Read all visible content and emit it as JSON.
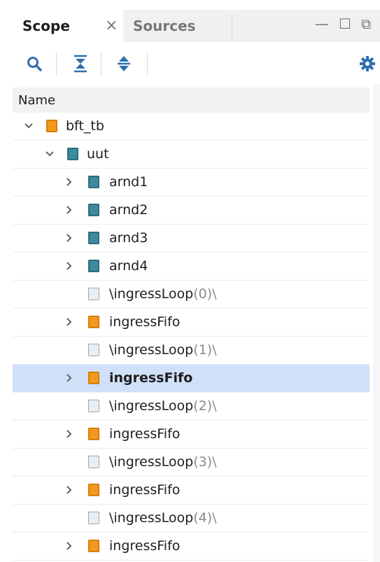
{
  "tabs": {
    "scope_label": "Scope",
    "close_glyph": "×",
    "sources_label": "Sources"
  },
  "window_controls": {
    "minimize": "—",
    "maximize": "☐",
    "float": "⧉"
  },
  "toolbar": {
    "icons": [
      "search-icon",
      "collapse-all-icon",
      "expand-all-icon",
      "gear-icon"
    ]
  },
  "tree": {
    "column_header": "Name",
    "rows": [
      {
        "label": "bft_tb",
        "suffix": "",
        "icon": "orange",
        "chevron": "down",
        "level": 0,
        "selected": false
      },
      {
        "label": "uut",
        "suffix": "",
        "icon": "teal",
        "chevron": "down",
        "level": 1,
        "selected": false
      },
      {
        "label": "arnd1",
        "suffix": "",
        "icon": "teal",
        "chevron": "right",
        "level": 2,
        "selected": false
      },
      {
        "label": "arnd2",
        "suffix": "",
        "icon": "teal",
        "chevron": "right",
        "level": 2,
        "selected": false
      },
      {
        "label": "arnd3",
        "suffix": "",
        "icon": "teal",
        "chevron": "right",
        "level": 2,
        "selected": false
      },
      {
        "label": "arnd4",
        "suffix": "",
        "icon": "teal",
        "chevron": "right",
        "level": 2,
        "selected": false
      },
      {
        "label": "\\ingressLoop",
        "suffix": "(0)\\",
        "icon": "gen",
        "chevron": "none",
        "level": 2,
        "selected": false
      },
      {
        "label": "ingressFifo",
        "suffix": "",
        "icon": "orange",
        "chevron": "right",
        "level": 2,
        "selected": false
      },
      {
        "label": "\\ingressLoop",
        "suffix": "(1)\\",
        "icon": "gen",
        "chevron": "none",
        "level": 2,
        "selected": false
      },
      {
        "label": "ingressFifo",
        "suffix": "",
        "icon": "orange",
        "chevron": "right",
        "level": 2,
        "selected": true
      },
      {
        "label": "\\ingressLoop",
        "suffix": "(2)\\",
        "icon": "gen",
        "chevron": "none",
        "level": 2,
        "selected": false
      },
      {
        "label": "ingressFifo",
        "suffix": "",
        "icon": "orange",
        "chevron": "right",
        "level": 2,
        "selected": false
      },
      {
        "label": "\\ingressLoop",
        "suffix": "(3)\\",
        "icon": "gen",
        "chevron": "none",
        "level": 2,
        "selected": false
      },
      {
        "label": "ingressFifo",
        "suffix": "",
        "icon": "orange",
        "chevron": "right",
        "level": 2,
        "selected": false
      },
      {
        "label": "\\ingressLoop",
        "suffix": "(4)\\",
        "icon": "gen",
        "chevron": "none",
        "level": 2,
        "selected": false
      },
      {
        "label": "ingressFifo",
        "suffix": "",
        "icon": "orange",
        "chevron": "right",
        "level": 2,
        "selected": false
      }
    ]
  },
  "scrollbar": {
    "up_glyph": "^"
  },
  "colors": {
    "selection": "#cfe0f8",
    "orange_module": "#f39a1e",
    "teal_module": "#3e8aa0"
  }
}
